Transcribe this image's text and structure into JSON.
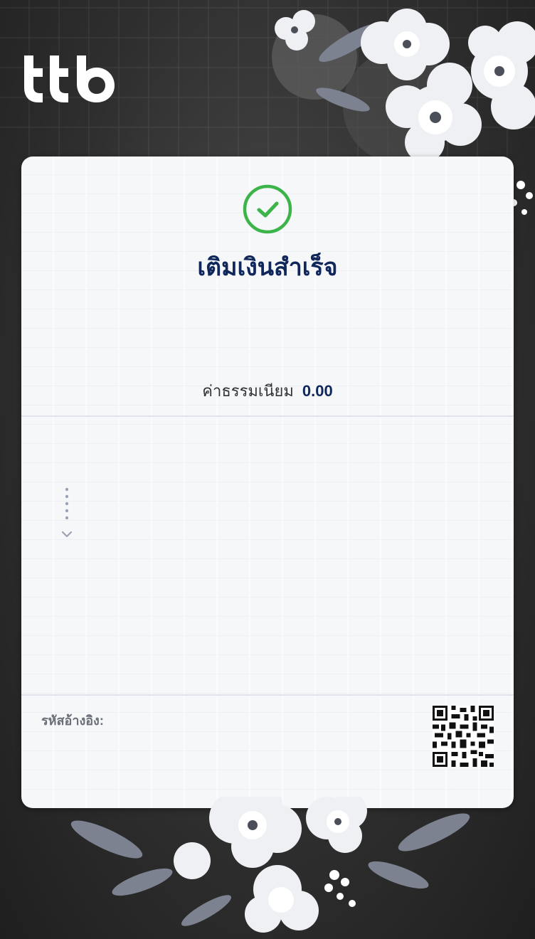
{
  "brand": {
    "logo_icon": "ttb-logo-icon"
  },
  "receipt": {
    "status_icon": "check-circle-icon",
    "title": "เติมเงินสำเร็จ",
    "fee_label": "ค่าธรรมเนียม",
    "fee_value": "0.00",
    "reference_label": "รหัสอ้างอิง:",
    "qr_icon": "qr-code-icon"
  },
  "colors": {
    "accent_green": "#3cb44a",
    "title_navy": "#10275c",
    "background": "#2f2f2f",
    "card": "#f6f7f9"
  }
}
